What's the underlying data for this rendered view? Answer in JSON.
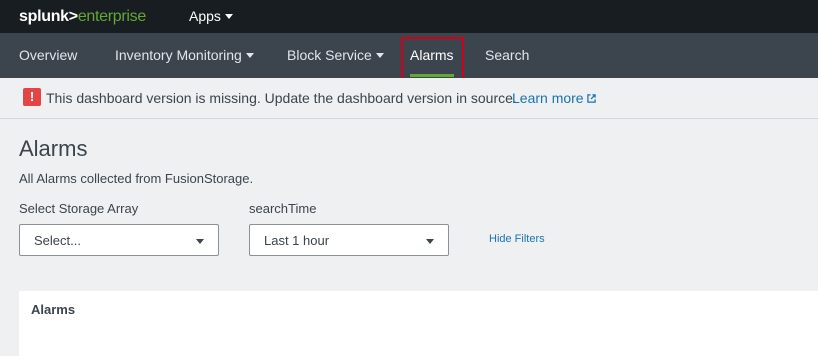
{
  "topbar": {
    "logo_primary": "splunk>",
    "logo_secondary": "enterprise",
    "apps_label": "Apps"
  },
  "nav": {
    "items": [
      {
        "label": "Overview"
      },
      {
        "label": "Inventory Monitoring"
      },
      {
        "label": "Block Service"
      },
      {
        "label": "Alarms"
      },
      {
        "label": "Search"
      }
    ],
    "active": "Alarms"
  },
  "warning": {
    "icon_text": "!",
    "message": "This dashboard version is missing. Update the dashboard version in source.",
    "link_label": "Learn more"
  },
  "dashboard": {
    "title": "Alarms",
    "description": "All Alarms collected from FusionStorage."
  },
  "filters": {
    "storage_array": {
      "label": "Select Storage Array",
      "value": "Select..."
    },
    "search_time": {
      "label": "searchTime",
      "value": "Last 1 hour"
    },
    "hide_filters_label": "Hide Filters"
  },
  "panel": {
    "title": "Alarms"
  },
  "colors": {
    "topbar_bg": "#171d21",
    "nav_bg": "#3c444d",
    "accent_green": "#65a637",
    "link_blue": "#1a73b5",
    "error_red": "#e04646",
    "highlight_red": "#d0021b"
  },
  "icons": {
    "warning": "error-icon",
    "external_link": "external-link-icon",
    "dropdown": "caret-down-icon"
  }
}
